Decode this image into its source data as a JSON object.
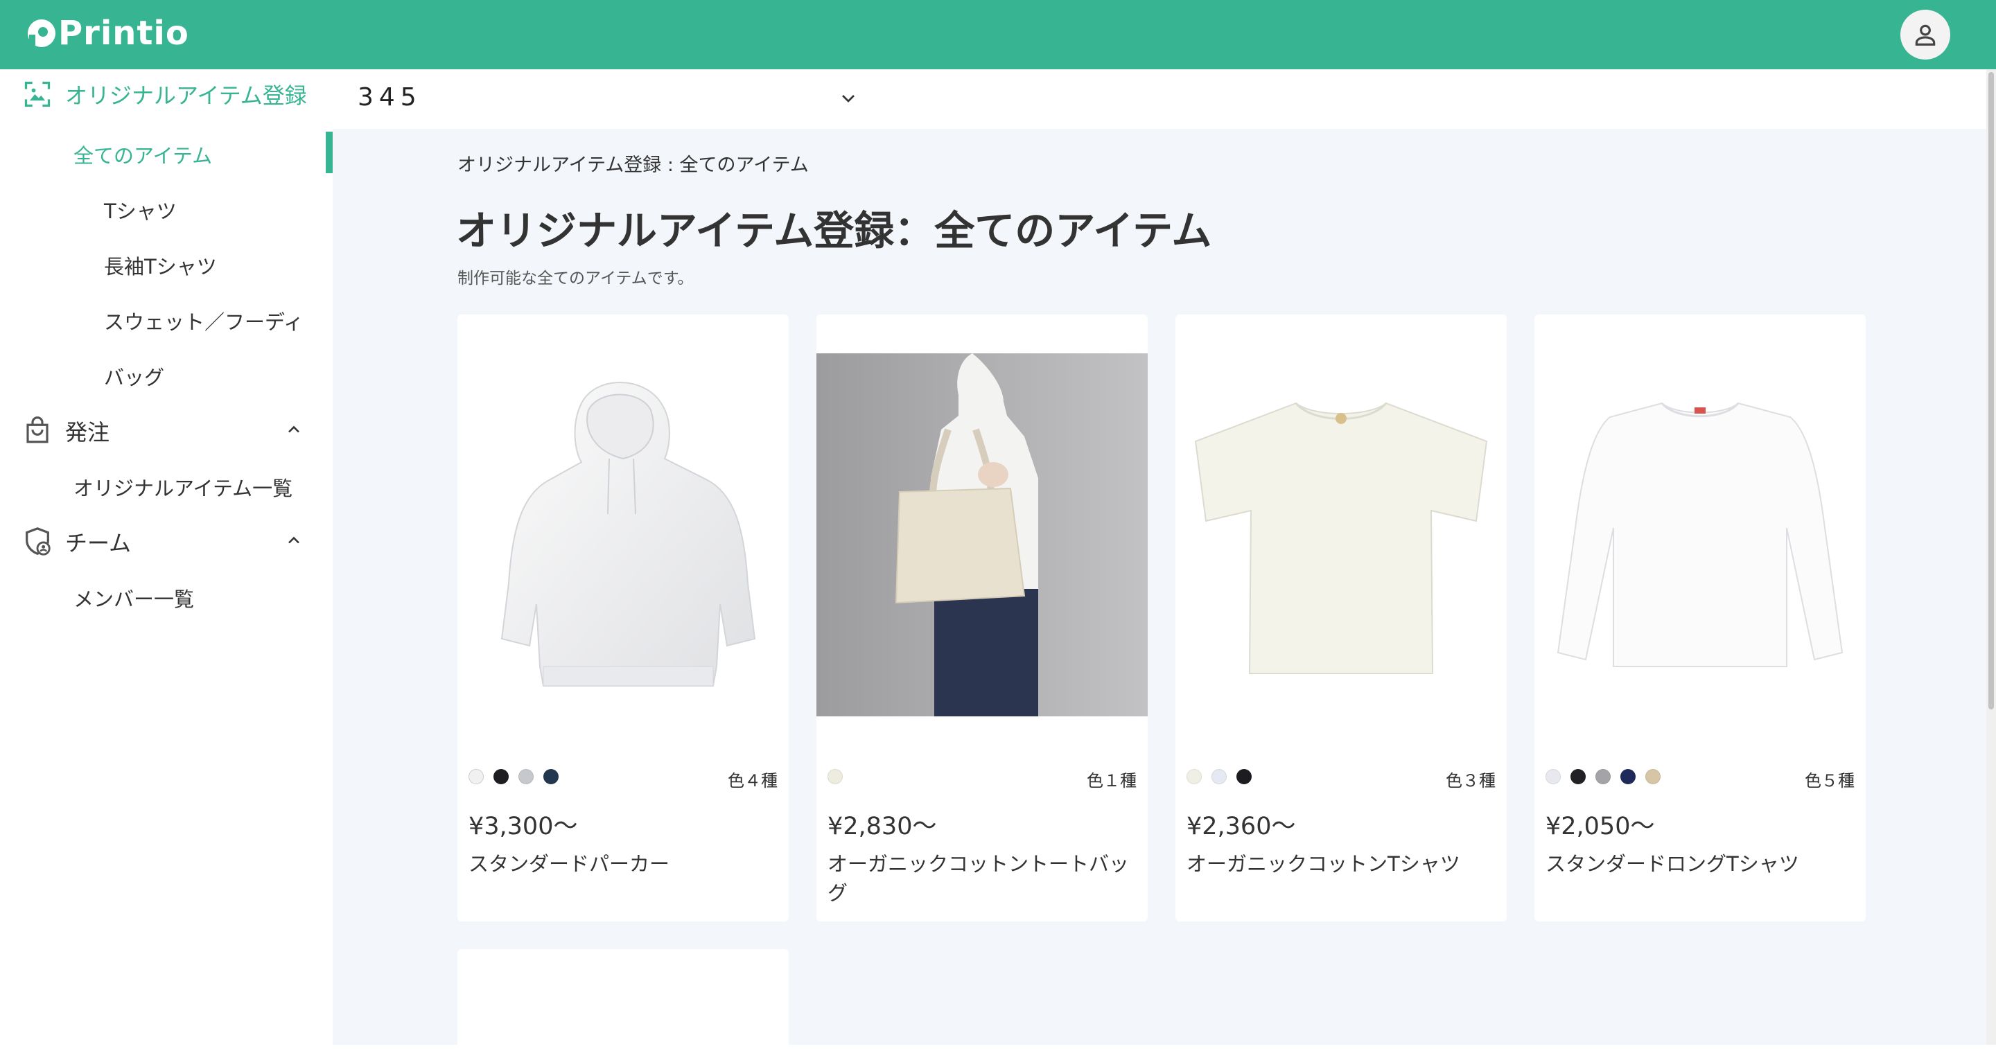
{
  "app": {
    "name": "Printio",
    "brand_color": "#37b492"
  },
  "header": {
    "logo_icon": "printio-logo-icon",
    "account_icon": "user-icon"
  },
  "sidebar": {
    "sections": [
      {
        "label": "オリジナルアイテム登録",
        "icon": "image-icon",
        "items": [
          {
            "label": "全てのアイテム",
            "level": 1,
            "active": true
          },
          {
            "label": "Tシャツ",
            "level": 2
          },
          {
            "label": "長袖Tシャツ",
            "level": 2
          },
          {
            "label": "スウェット／フーディ",
            "level": 2
          },
          {
            "label": "バッグ",
            "level": 2
          }
        ]
      },
      {
        "label": "発注",
        "icon": "shopping-bag-icon",
        "expanded": true,
        "items": [
          {
            "label": "オリジナルアイテム一覧",
            "level": 1
          }
        ]
      },
      {
        "label": "チーム",
        "icon": "team-shield-icon",
        "expanded": true,
        "items": [
          {
            "label": "メンバー一覧",
            "level": 1
          }
        ]
      }
    ]
  },
  "selector": {
    "value": "345",
    "icon": "chevron-down-icon"
  },
  "page": {
    "breadcrumb": "オリジナルアイテム登録 : 全てのアイテム",
    "title": "オリジナルアイテム登録：全てのアイテム",
    "description": "制作可能な全てのアイテムです。"
  },
  "products": [
    {
      "name": "スタンダードパーカー",
      "price": "¥3,300〜",
      "color_count": "色４種",
      "colors": [
        "#f1f1f1",
        "#1e1e22",
        "#c6c8ce",
        "#233850"
      ],
      "image": "hoodie-image"
    },
    {
      "name": "オーガニックコットントートバッグ",
      "price": "¥2,830〜",
      "color_count": "色１種",
      "colors": [
        "#eeecdf"
      ],
      "image": "tote-bag-image"
    },
    {
      "name": "オーガニックコットンTシャツ",
      "price": "¥2,360〜",
      "color_count": "色３種",
      "colors": [
        "#f0efe5",
        "#e6e8f2",
        "#1d1d21"
      ],
      "image": "tshirt-image"
    },
    {
      "name": "スタンダードロングTシャツ",
      "price": "¥2,050〜",
      "color_count": "色５種",
      "colors": [
        "#e8e9ee",
        "#222226",
        "#a4a4a8",
        "#1f2a5a",
        "#d6c6a6"
      ],
      "image": "long-tshirt-image"
    }
  ]
}
